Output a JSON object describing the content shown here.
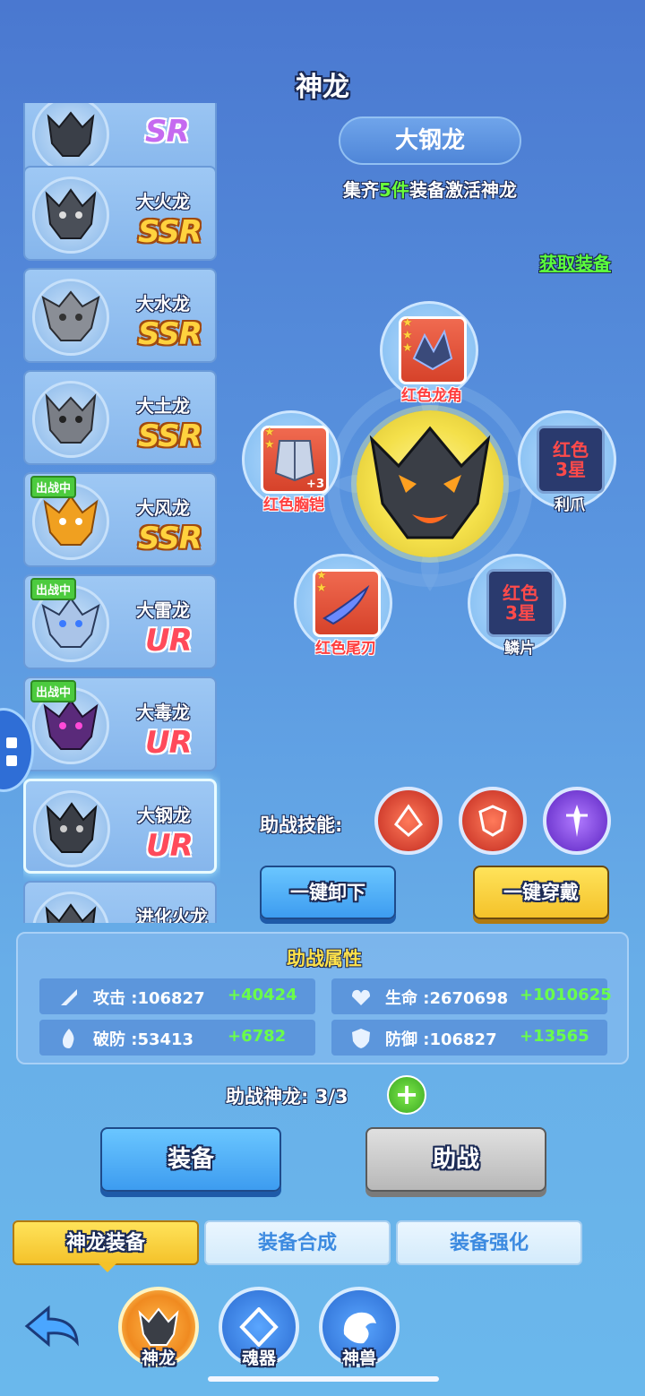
{
  "title": "神龙",
  "dragons": [
    {
      "name": "",
      "rarity": "SR",
      "tier": "sr",
      "status": ""
    },
    {
      "name": "大火龙",
      "rarity": "SSR",
      "tier": "ssr",
      "status": ""
    },
    {
      "name": "大水龙",
      "rarity": "SSR",
      "tier": "ssr",
      "status": ""
    },
    {
      "name": "大土龙",
      "rarity": "SSR",
      "tier": "ssr",
      "status": ""
    },
    {
      "name": "大风龙",
      "rarity": "SSR",
      "tier": "ssr",
      "status": "出战中"
    },
    {
      "name": "大雷龙",
      "rarity": "UR",
      "tier": "ur",
      "status": "出战中"
    },
    {
      "name": "大毒龙",
      "rarity": "UR",
      "tier": "ur",
      "status": "出战中"
    },
    {
      "name": "大钢龙",
      "rarity": "UR",
      "tier": "ur",
      "status": ""
    },
    {
      "name": "进化火龙",
      "rarity": "",
      "tier": "",
      "status": ""
    }
  ],
  "selected": {
    "name": "大钢龙",
    "collect_prefix": "集齐",
    "collect_count": "5件",
    "collect_suffix": "装备激活神龙",
    "obtain_link": "获取装备"
  },
  "equipment": {
    "horn": {
      "label": "红色龙角"
    },
    "chest": {
      "label": "红色胸铠",
      "level": "+3"
    },
    "claw": {
      "label": "利爪",
      "requirement": "红色\n3星"
    },
    "tail": {
      "label": "红色尾刃"
    },
    "scale": {
      "label": "鳞片",
      "requirement": "红色\n3星"
    }
  },
  "skills": {
    "label": "助战技能:"
  },
  "buttons": {
    "unequip_all": "一键卸下",
    "equip_all": "一键穿戴",
    "equip": "装备",
    "assist": "助战"
  },
  "attributes": {
    "title": "助战属性",
    "attack": {
      "label": "攻击 :106827",
      "bonus": "+40424"
    },
    "hp": {
      "label": "生命 :2670698",
      "bonus": "+1010625"
    },
    "pierce": {
      "label": "破防 :53413",
      "bonus": "+6782"
    },
    "defense": {
      "label": "防御 :106827",
      "bonus": "+13565"
    }
  },
  "assist_count": "助战神龙: 3/3",
  "tabs": [
    "神龙装备",
    "装备合成",
    "装备强化"
  ],
  "nav": [
    "神龙",
    "魂器",
    "神兽"
  ],
  "colors": {
    "accent_yellow": "#f4c22a",
    "accent_blue": "#3d9cf0",
    "bonus_green": "#6aff4a"
  }
}
